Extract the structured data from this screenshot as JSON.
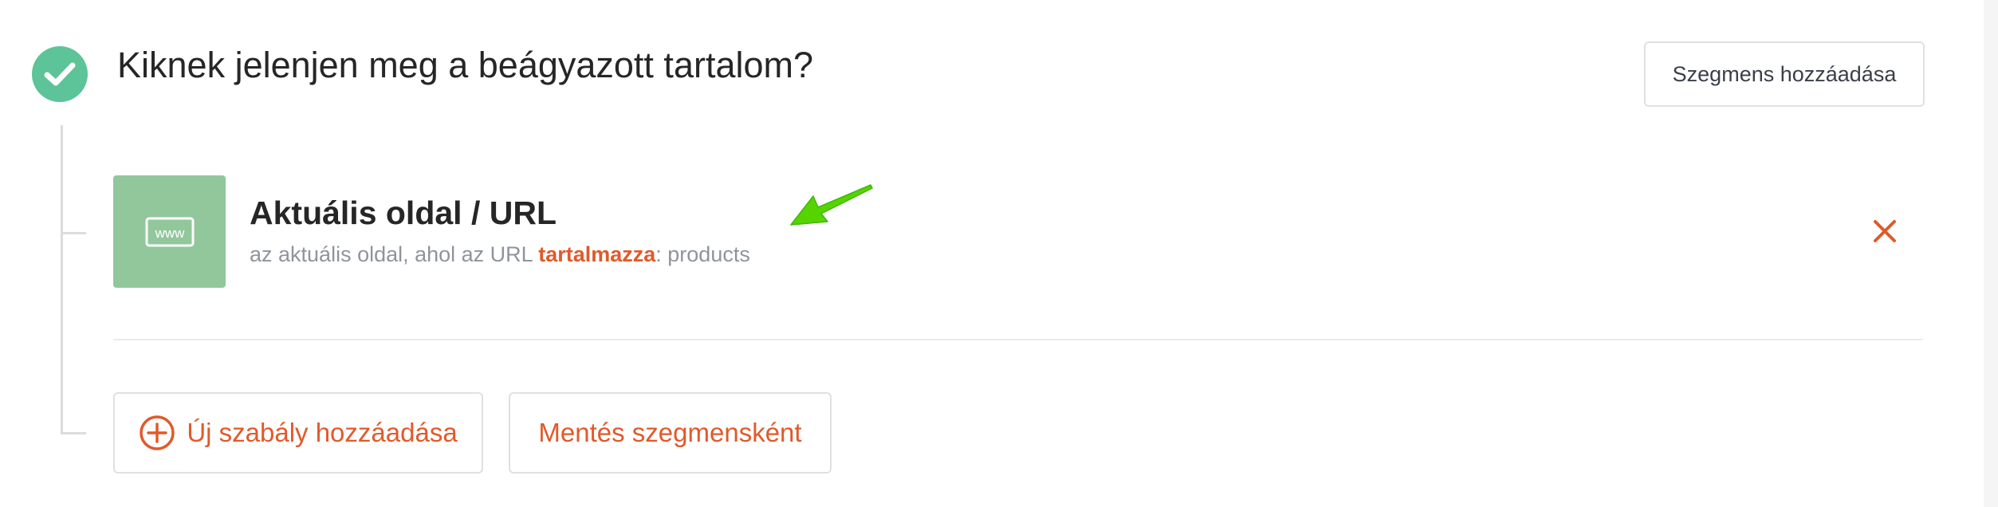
{
  "header": {
    "title": "Kiknek jelenjen meg a beágyazott tartalom?",
    "add_segment_label": "Szegmens hozzáadása"
  },
  "rule": {
    "icon_text": "www",
    "title": "Aktuális oldal / URL",
    "desc_prefix": "az aktuális oldal, ahol az URL ",
    "desc_operator": "tartalmazza",
    "desc_value": ": products"
  },
  "actions": {
    "add_rule_label": "Új szabály hozzáadása",
    "save_segment_label": "Mentés szegmensként"
  },
  "colors": {
    "success": "#5cc498",
    "rule_icon_bg": "#92c79c",
    "accent": "#e05a2b",
    "annotation_arrow": "#55d400",
    "text_primary": "#262626",
    "text_muted": "#8f949c"
  },
  "icons": {
    "status": "check-icon",
    "rule": "www-icon",
    "remove": "close-icon",
    "add": "plus-circle-icon",
    "annotation": "arrow-annotation"
  }
}
